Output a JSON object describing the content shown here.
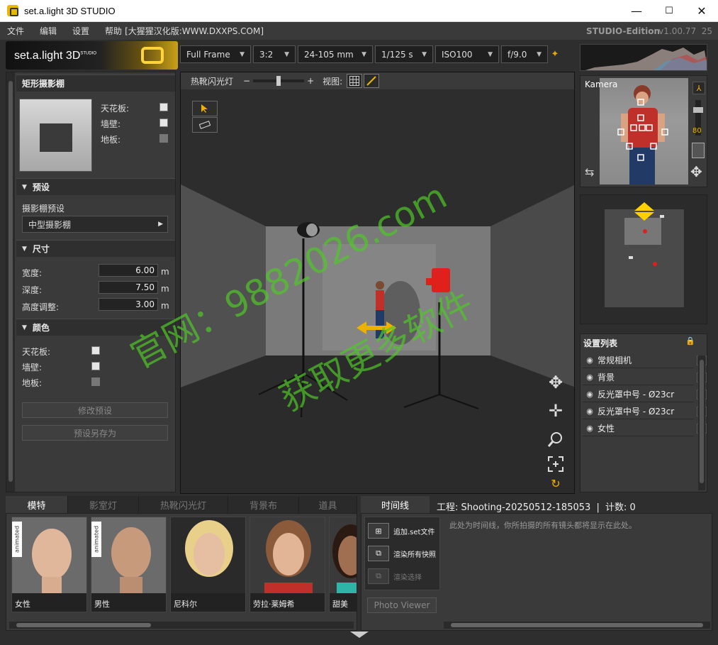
{
  "window": {
    "title": "set.a.light 3D STUDIO",
    "min": "—",
    "max": "☐",
    "close": "✕"
  },
  "menu": {
    "items": [
      "文件",
      "编辑",
      "设置",
      "帮助"
    ],
    "banner": "[大猩猩汉化版:WWW.DXXPS.COM]",
    "edition": "STUDIO-Edition",
    "version": "v1.00.77",
    "build": "25"
  },
  "logo": {
    "text": "set.a.light 3D",
    "sup": "STUDIO"
  },
  "camera_settings": {
    "sensor": "Full Frame",
    "ratio": "3:2",
    "lens": "24-105 mm",
    "shutter": "1/125 s",
    "iso": "ISO100",
    "aperture": "f/9.0"
  },
  "left_panel": {
    "studio_title": "矩形摄影棚",
    "ceiling_label": "天花板:",
    "wall_label": "墙壁:",
    "floor_label": "地板:",
    "preset_section": "预设",
    "preset_label": "摄影棚预设",
    "preset_value": "中型摄影棚",
    "size_section": "尺寸",
    "width_label": "宽度:",
    "width_value": "6.00",
    "depth_label": "深度:",
    "depth_value": "7.50",
    "height_label": "高度调整:",
    "height_value": "3.00",
    "unit": "m",
    "color_section": "颜色",
    "color_ceiling": "天花板:",
    "color_wall": "墙壁:",
    "color_floor": "地板:",
    "modify_preset": "修改预设",
    "save_preset_as": "预设另存为"
  },
  "viewport": {
    "hotshoe_label": "热靴闪光灯",
    "minus": "−",
    "plus": "+",
    "view_label": "视图:"
  },
  "camera_panel": {
    "label": "Kamera",
    "zoom": "80"
  },
  "setlist": {
    "title": "设置列表",
    "items": [
      "常规相机",
      "背景",
      "反光罩中号 - Ø23cr",
      "反光罩中号 - Ø23cr",
      "女性"
    ]
  },
  "bottom_tabs": [
    "模特",
    "影室灯",
    "热靴闪光灯",
    "背景布",
    "道具"
  ],
  "models": [
    {
      "name": "女性",
      "animated": "animated"
    },
    {
      "name": "男性",
      "animated": "animated"
    },
    {
      "name": "尼科尔"
    },
    {
      "name": "劳拉·莱姆希"
    },
    {
      "name": "甜美"
    }
  ],
  "timeline": {
    "tab": "时间线",
    "project": "工程: Shooting-20250512-185053",
    "separator": "|",
    "count": "计数: 0",
    "add_set": "追加.set文件",
    "render_all": "渲染所有快照",
    "render_selected": "渲染选择",
    "photo_viewer": "Photo Viewer",
    "hint": "此处为时间线，你所拍摄的所有镜头都将显示在此处。"
  },
  "watermark": {
    "line1": "官网：9882026.com",
    "line2": "获取更多软件"
  },
  "colors": {
    "accent": "#ffcc33",
    "light_red": "#e0201a"
  }
}
